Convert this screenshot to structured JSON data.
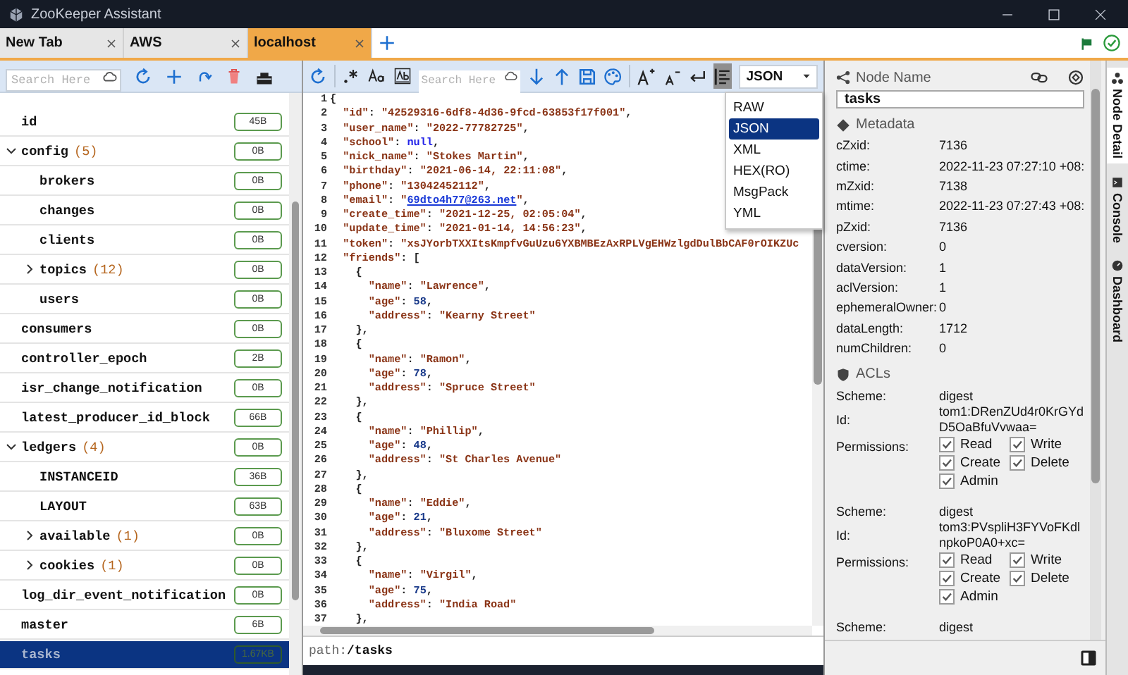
{
  "window": {
    "title": "ZooKeeper Assistant"
  },
  "tabs": [
    {
      "label": "New Tab",
      "selected": false
    },
    {
      "label": "AWS",
      "selected": false
    },
    {
      "label": "localhost",
      "selected": true
    }
  ],
  "tree": {
    "search": {
      "placeholder": "Search Here"
    },
    "nodes": [
      {
        "name": "id",
        "size": "45B",
        "selected": false
      },
      {
        "name": "config",
        "count": "(5)",
        "size": "0B",
        "selected": false,
        "expanded": true,
        "children": [
          {
            "name": "brokers",
            "size": "0B",
            "selected": false
          },
          {
            "name": "changes",
            "size": "0B",
            "selected": false
          },
          {
            "name": "clients",
            "size": "0B",
            "selected": false
          },
          {
            "name": "topics",
            "count": "(12)",
            "size": "0B",
            "selected": false,
            "expanded": false
          },
          {
            "name": "users",
            "size": "0B",
            "selected": false
          }
        ]
      },
      {
        "name": "consumers",
        "size": "0B",
        "selected": false
      },
      {
        "name": "controller_epoch",
        "size": "2B",
        "selected": false
      },
      {
        "name": "isr_change_notification",
        "size": "0B",
        "selected": false
      },
      {
        "name": "latest_producer_id_block",
        "size": "66B",
        "selected": false
      },
      {
        "name": "ledgers",
        "count": "(4)",
        "size": "0B",
        "selected": false,
        "expanded": true,
        "children": [
          {
            "name": "INSTANCEID",
            "size": "36B",
            "selected": false
          },
          {
            "name": "LAYOUT",
            "size": "63B",
            "selected": false
          },
          {
            "name": "available",
            "count": "(1)",
            "size": "0B",
            "selected": false,
            "expanded": false
          },
          {
            "name": "cookies",
            "count": "(1)",
            "size": "0B",
            "selected": false,
            "expanded": false
          }
        ]
      },
      {
        "name": "log_dir_event_notification",
        "size": "0B",
        "selected": false
      },
      {
        "name": "master",
        "size": "6B",
        "selected": false
      },
      {
        "name": "tasks",
        "size": "1.67KB",
        "selected": true
      }
    ]
  },
  "editor": {
    "search": {
      "placeholder": "Search Here"
    },
    "format_button": {
      "on": true
    },
    "format": {
      "value": "JSON",
      "open": true,
      "options": [
        {
          "label": "RAW",
          "selected": false
        },
        {
          "label": "JSON",
          "selected": true
        },
        {
          "label": "XML",
          "selected": false
        },
        {
          "label": "HEX(RO)",
          "selected": false
        },
        {
          "label": "MsgPack",
          "selected": false
        },
        {
          "label": "YML",
          "selected": false
        }
      ]
    },
    "lines": [
      {
        "number": "1",
        "text": "{"
      },
      {
        "number": "2",
        "text": "  \"id\": \"42529316-6df8-4d36-9fcd-63853f17f001\","
      },
      {
        "number": "3",
        "text": "  \"user_name\": \"2022-77782725\","
      },
      {
        "number": "4",
        "text": "  \"school\": null,"
      },
      {
        "number": "5",
        "text": "  \"nick_name\": \"Stokes Martin\","
      },
      {
        "number": "6",
        "text": "  \"birthday\": \"2021-06-14, 22:11:08\","
      },
      {
        "number": "7",
        "text": "  \"phone\": \"13042452112\","
      },
      {
        "number": "8",
        "text": "  \"email\": \"69dto4h77@263.net\","
      },
      {
        "number": "9",
        "text": "  \"create_time\": \"2021-12-25, 02:05:04\","
      },
      {
        "number": "10",
        "text": "  \"update_time\": \"2021-01-14, 14:56:23\","
      },
      {
        "number": "11",
        "text": "  \"token\": \"xsJYorbTXXItsKmpfvGuUzu6YXBMBEzAxRPLVgEHWzlgdDulBbCAF0rOIKZUc"
      },
      {
        "number": "12",
        "text": "  \"friends\": ["
      },
      {
        "number": "13",
        "text": "    {"
      },
      {
        "number": "14",
        "text": "      \"name\": \"Lawrence\","
      },
      {
        "number": "15",
        "text": "      \"age\": 58,"
      },
      {
        "number": "16",
        "text": "      \"address\": \"Kearny Street\""
      },
      {
        "number": "17",
        "text": "    },"
      },
      {
        "number": "18",
        "text": "    {"
      },
      {
        "number": "19",
        "text": "      \"name\": \"Ramon\","
      },
      {
        "number": "20",
        "text": "      \"age\": 78,"
      },
      {
        "number": "21",
        "text": "      \"address\": \"Spruce Street\""
      },
      {
        "number": "22",
        "text": "    },"
      },
      {
        "number": "23",
        "text": "    {"
      },
      {
        "number": "24",
        "text": "      \"name\": \"Phillip\","
      },
      {
        "number": "25",
        "text": "      \"age\": 48,"
      },
      {
        "number": "26",
        "text": "      \"address\": \"St Charles Avenue\""
      },
      {
        "number": "27",
        "text": "    },"
      },
      {
        "number": "28",
        "text": "    {"
      },
      {
        "number": "29",
        "text": "      \"name\": \"Eddie\","
      },
      {
        "number": "30",
        "text": "      \"age\": 21,"
      },
      {
        "number": "31",
        "text": "      \"address\": \"Bluxome Street\""
      },
      {
        "number": "32",
        "text": "    },"
      },
      {
        "number": "33",
        "text": "    {"
      },
      {
        "number": "34",
        "text": "      \"name\": \"Virgil\","
      },
      {
        "number": "35",
        "text": "      \"age\": 75,"
      },
      {
        "number": "36",
        "text": "      \"address\": \"India Road\""
      },
      {
        "number": "37",
        "text": "    },"
      }
    ],
    "path": "path:**/tasks**"
  },
  "node_detail": {
    "title": "Node Name",
    "name": "tasks",
    "metadata_title": "Metadata",
    "metadata": [
      {
        "label": "cZxid:",
        "value": "7136"
      },
      {
        "label": "ctime:",
        "value": "2022-11-23 07:27:10 +08:"
      },
      {
        "label": "mZxid:",
        "value": "7138"
      },
      {
        "label": "mtime:",
        "value": "2022-11-23 07:27:43 +08:"
      },
      {
        "label": "pZxid:",
        "value": "7136"
      },
      {
        "label": "cversion:",
        "value": "0"
      },
      {
        "label": "dataVersion:",
        "value": "1"
      },
      {
        "label": "aclVersion:",
        "value": "1"
      },
      {
        "label": "ephemeralOwner:",
        "value": "0"
      },
      {
        "label": "dataLength:",
        "value": "1712"
      },
      {
        "label": "numChildren:",
        "value": "0"
      }
    ],
    "acls_title": "ACLs",
    "acls": [
      {
        "scheme_label": "Scheme:",
        "scheme": "digest",
        "id_label": "Id:",
        "id": "tom1:DRenZUd4r0KrGYdD5OaBfuVvwaa=",
        "permissions_label": "Permissions:",
        "permissions": [
          {
            "label": "Read",
            "checked": true
          },
          {
            "label": "Write",
            "checked": true
          },
          {
            "label": "Create",
            "checked": true
          },
          {
            "label": "Delete",
            "checked": true
          },
          {
            "label": "Admin",
            "checked": true
          }
        ]
      },
      {
        "scheme_label": "Scheme:",
        "scheme": "digest",
        "id_label": "Id:",
        "id": "tom3:PVspliH3FYVoFKdlnpkoP0A0+xc=",
        "permissions_label": "Permissions:",
        "permissions": [
          {
            "label": "Read",
            "checked": true
          },
          {
            "label": "Write",
            "checked": true
          },
          {
            "label": "Create",
            "checked": true
          },
          {
            "label": "Delete",
            "checked": true
          },
          {
            "label": "Admin",
            "checked": true
          }
        ]
      },
      {
        "scheme_label": "Scheme:",
        "scheme": "digest"
      }
    ]
  },
  "side_tabs": [
    {
      "label": "Node Detail",
      "selected": true
    },
    {
      "label": "Console",
      "selected": false
    },
    {
      "label": "Dashboard",
      "selected": false
    }
  ]
}
